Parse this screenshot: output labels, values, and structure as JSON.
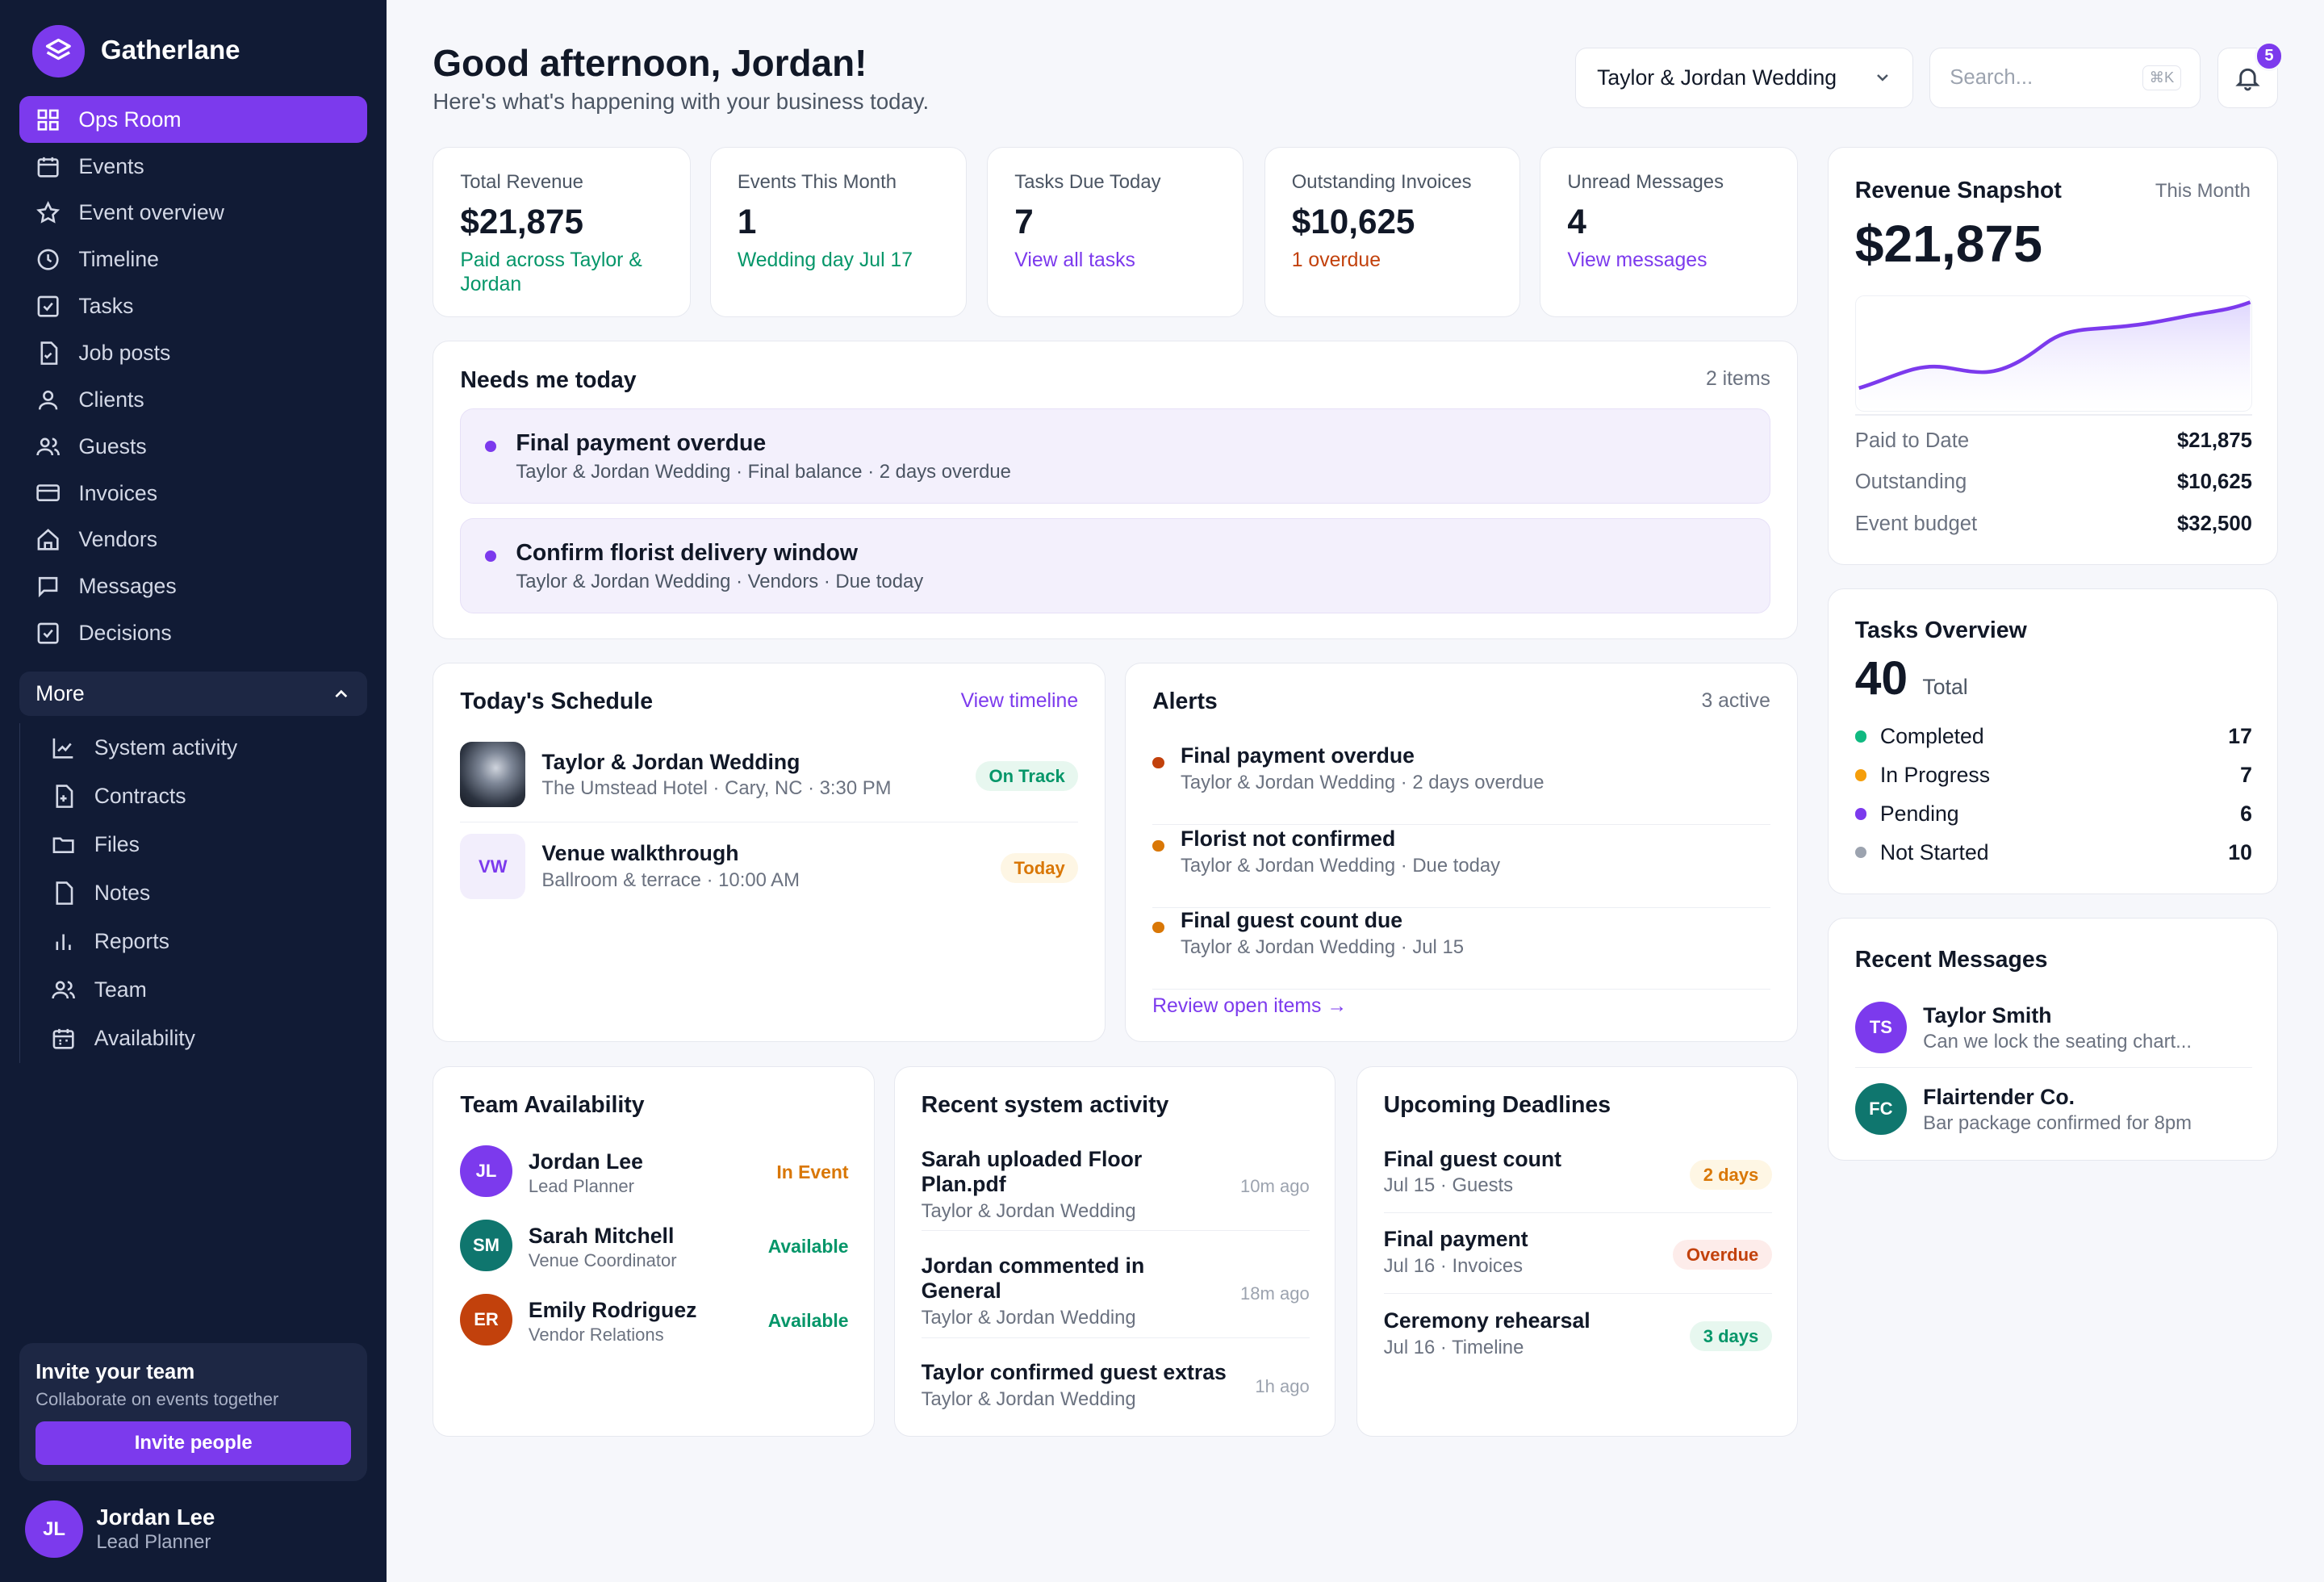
{
  "app": {
    "name": "Gatherlane"
  },
  "sidebar": {
    "items": [
      {
        "label": "Ops Room",
        "icon": "grid-icon"
      },
      {
        "label": "Events",
        "icon": "calendar-icon"
      },
      {
        "label": "Event overview",
        "icon": "star-icon"
      },
      {
        "label": "Timeline",
        "icon": "clock-icon"
      },
      {
        "label": "Tasks",
        "icon": "check-square-icon"
      },
      {
        "label": "Job posts",
        "icon": "file-check-icon"
      },
      {
        "label": "Clients",
        "icon": "user-icon"
      },
      {
        "label": "Guests",
        "icon": "users-icon"
      },
      {
        "label": "Invoices",
        "icon": "credit-card-icon"
      },
      {
        "label": "Vendors",
        "icon": "home-icon"
      },
      {
        "label": "Messages",
        "icon": "message-icon"
      },
      {
        "label": "Decisions",
        "icon": "check-square-icon"
      }
    ],
    "more_label": "More",
    "more_items": [
      {
        "label": "System activity",
        "icon": "activity-chart-icon"
      },
      {
        "label": "Contracts",
        "icon": "file-plus-icon"
      },
      {
        "label": "Files",
        "icon": "folder-icon"
      },
      {
        "label": "Notes",
        "icon": "note-icon"
      },
      {
        "label": "Reports",
        "icon": "bar-chart-icon"
      },
      {
        "label": "Team",
        "icon": "users-icon"
      },
      {
        "label": "Availability",
        "icon": "calendar-grid-icon"
      }
    ],
    "invite": {
      "title": "Invite your team",
      "subtitle": "Collaborate on events together",
      "button": "Invite people"
    },
    "user": {
      "initials": "JL",
      "name": "Jordan Lee",
      "role": "Lead Planner"
    }
  },
  "header": {
    "greeting": "Good afternoon, Jordan!",
    "subtitle": "Here's what's happening with your business today.",
    "event_select": "Taylor & Jordan Wedding",
    "search_placeholder": "Search...",
    "search_shortcut": "⌘K",
    "notification_count": "5"
  },
  "stats": [
    {
      "label": "Total Revenue",
      "value": "$21,875",
      "sub": "Paid across Taylor & Jordan",
      "tone": "green"
    },
    {
      "label": "Events This Month",
      "value": "1",
      "sub": "Wedding day Jul 17",
      "tone": "green"
    },
    {
      "label": "Tasks Due Today",
      "value": "7",
      "sub": "View all tasks",
      "tone": "purple"
    },
    {
      "label": "Outstanding Invoices",
      "value": "$10,625",
      "sub": "1 overdue",
      "tone": "orange"
    },
    {
      "label": "Unread Messages",
      "value": "4",
      "sub": "View messages",
      "tone": "purple"
    }
  ],
  "needs": {
    "title": "Needs me today",
    "count": "2 items",
    "items": [
      {
        "title": "Final payment overdue",
        "sub": "Taylor & Jordan Wedding · Final balance · 2 days overdue"
      },
      {
        "title": "Confirm florist delivery window",
        "sub": "Taylor & Jordan Wedding · Vendors · Due today"
      }
    ]
  },
  "schedule": {
    "title": "Today's Schedule",
    "link": "View timeline",
    "items": [
      {
        "title": "Taylor & Jordan Wedding",
        "sub": "The Umstead Hotel · Cary, NC · 3:30 PM",
        "badge": "On Track"
      },
      {
        "initials": "VW",
        "title": "Venue walkthrough",
        "sub": "Ballroom & terrace · 10:00 AM",
        "badge": "Today"
      }
    ]
  },
  "alerts": {
    "title": "Alerts",
    "count": "3 active",
    "items": [
      {
        "title": "Final payment overdue",
        "sub": "Taylor & Jordan Wedding · 2 days overdue",
        "color": "#c2410c"
      },
      {
        "title": "Florist not confirmed",
        "sub": "Taylor & Jordan Wedding · Due today",
        "color": "#d97706"
      },
      {
        "title": "Final guest count due",
        "sub": "Taylor & Jordan Wedding · Jul 15",
        "color": "#d97706"
      }
    ],
    "link": "Review open items →"
  },
  "team": {
    "title": "Team Availability",
    "members": [
      {
        "initials": "JL",
        "name": "Jordan Lee",
        "role": "Lead Planner",
        "status": "In Event",
        "color": "#7c3aed"
      },
      {
        "initials": "SM",
        "name": "Sarah Mitchell",
        "role": "Venue Coordinator",
        "status": "Available",
        "color": "#0f766e"
      },
      {
        "initials": "ER",
        "name": "Emily Rodriguez",
        "role": "Vendor Relations",
        "status": "Available",
        "color": "#c2410c"
      }
    ]
  },
  "activity": {
    "title": "Recent system activity",
    "items": [
      {
        "title": "Sarah uploaded Floor Plan.pdf",
        "sub": "Taylor & Jordan Wedding",
        "time": "10m ago"
      },
      {
        "title": "Jordan commented in General",
        "sub": "Taylor & Jordan Wedding",
        "time": "18m ago"
      },
      {
        "title": "Taylor confirmed guest extras",
        "sub": "Taylor & Jordan Wedding",
        "time": "1h ago"
      }
    ]
  },
  "deadlines": {
    "title": "Upcoming Deadlines",
    "items": [
      {
        "title": "Final guest count",
        "sub": "Jul 15 · Guests",
        "badge": "2 days"
      },
      {
        "title": "Final payment",
        "sub": "Jul 16 · Invoices",
        "badge": "Overdue"
      },
      {
        "title": "Ceremony rehearsal",
        "sub": "Jul 16 · Timeline",
        "badge": "3 days"
      }
    ]
  },
  "revenue": {
    "title": "Revenue Snapshot",
    "period": "This Month",
    "value": "$21,875",
    "rows": [
      {
        "label": "Paid to Date",
        "value": "$21,875"
      },
      {
        "label": "Outstanding",
        "value": "$10,625"
      },
      {
        "label": "Event budget",
        "value": "$32,500"
      }
    ]
  },
  "tasks_overview": {
    "title": "Tasks Overview",
    "total": "40",
    "total_label": "Total",
    "rows": [
      {
        "label": "Completed",
        "value": "17",
        "color": "#10b981"
      },
      {
        "label": "In Progress",
        "value": "7",
        "color": "#f59e0b"
      },
      {
        "label": "Pending",
        "value": "6",
        "color": "#7c3aed"
      },
      {
        "label": "Not Started",
        "value": "10",
        "color": "#9ca3af"
      }
    ]
  },
  "messages": {
    "title": "Recent Messages",
    "items": [
      {
        "initials": "TS",
        "name": "Taylor Smith",
        "preview": "Can we lock the seating chart...",
        "color": "#7c3aed"
      },
      {
        "initials": "FC",
        "name": "Flairtender Co.",
        "preview": "Bar package confirmed for 8pm",
        "color": "#0f766e"
      }
    ]
  }
}
